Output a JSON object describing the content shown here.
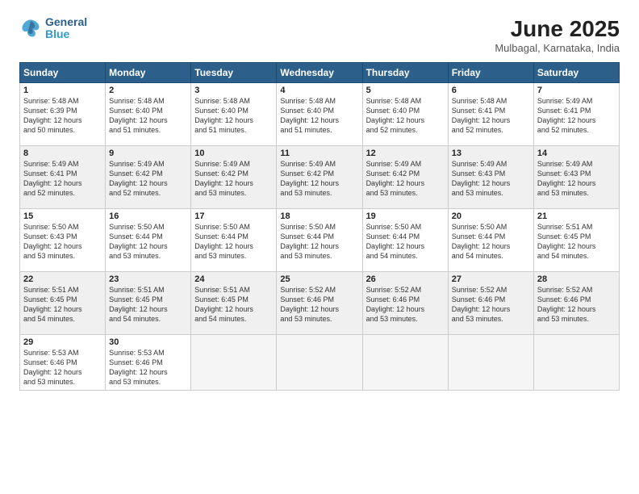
{
  "logo": {
    "line1": "General",
    "line2": "Blue"
  },
  "title": "June 2025",
  "location": "Mulbagal, Karnataka, India",
  "days_header": [
    "Sunday",
    "Monday",
    "Tuesday",
    "Wednesday",
    "Thursday",
    "Friday",
    "Saturday"
  ],
  "weeks": [
    [
      {
        "day": "1",
        "sunrise": "5:48 AM",
        "sunset": "6:39 PM",
        "daylight": "12 hours and 50 minutes."
      },
      {
        "day": "2",
        "sunrise": "5:48 AM",
        "sunset": "6:40 PM",
        "daylight": "12 hours and 51 minutes."
      },
      {
        "day": "3",
        "sunrise": "5:48 AM",
        "sunset": "6:40 PM",
        "daylight": "12 hours and 51 minutes."
      },
      {
        "day": "4",
        "sunrise": "5:48 AM",
        "sunset": "6:40 PM",
        "daylight": "12 hours and 51 minutes."
      },
      {
        "day": "5",
        "sunrise": "5:48 AM",
        "sunset": "6:40 PM",
        "daylight": "12 hours and 52 minutes."
      },
      {
        "day": "6",
        "sunrise": "5:48 AM",
        "sunset": "6:41 PM",
        "daylight": "12 hours and 52 minutes."
      },
      {
        "day": "7",
        "sunrise": "5:49 AM",
        "sunset": "6:41 PM",
        "daylight": "12 hours and 52 minutes."
      }
    ],
    [
      {
        "day": "8",
        "sunrise": "5:49 AM",
        "sunset": "6:41 PM",
        "daylight": "12 hours and 52 minutes."
      },
      {
        "day": "9",
        "sunrise": "5:49 AM",
        "sunset": "6:42 PM",
        "daylight": "12 hours and 52 minutes."
      },
      {
        "day": "10",
        "sunrise": "5:49 AM",
        "sunset": "6:42 PM",
        "daylight": "12 hours and 53 minutes."
      },
      {
        "day": "11",
        "sunrise": "5:49 AM",
        "sunset": "6:42 PM",
        "daylight": "12 hours and 53 minutes."
      },
      {
        "day": "12",
        "sunrise": "5:49 AM",
        "sunset": "6:42 PM",
        "daylight": "12 hours and 53 minutes."
      },
      {
        "day": "13",
        "sunrise": "5:49 AM",
        "sunset": "6:43 PM",
        "daylight": "12 hours and 53 minutes."
      },
      {
        "day": "14",
        "sunrise": "5:49 AM",
        "sunset": "6:43 PM",
        "daylight": "12 hours and 53 minutes."
      }
    ],
    [
      {
        "day": "15",
        "sunrise": "5:50 AM",
        "sunset": "6:43 PM",
        "daylight": "12 hours and 53 minutes."
      },
      {
        "day": "16",
        "sunrise": "5:50 AM",
        "sunset": "6:44 PM",
        "daylight": "12 hours and 53 minutes."
      },
      {
        "day": "17",
        "sunrise": "5:50 AM",
        "sunset": "6:44 PM",
        "daylight": "12 hours and 53 minutes."
      },
      {
        "day": "18",
        "sunrise": "5:50 AM",
        "sunset": "6:44 PM",
        "daylight": "12 hours and 53 minutes."
      },
      {
        "day": "19",
        "sunrise": "5:50 AM",
        "sunset": "6:44 PM",
        "daylight": "12 hours and 54 minutes."
      },
      {
        "day": "20",
        "sunrise": "5:50 AM",
        "sunset": "6:44 PM",
        "daylight": "12 hours and 54 minutes."
      },
      {
        "day": "21",
        "sunrise": "5:51 AM",
        "sunset": "6:45 PM",
        "daylight": "12 hours and 54 minutes."
      }
    ],
    [
      {
        "day": "22",
        "sunrise": "5:51 AM",
        "sunset": "6:45 PM",
        "daylight": "12 hours and 54 minutes."
      },
      {
        "day": "23",
        "sunrise": "5:51 AM",
        "sunset": "6:45 PM",
        "daylight": "12 hours and 54 minutes."
      },
      {
        "day": "24",
        "sunrise": "5:51 AM",
        "sunset": "6:45 PM",
        "daylight": "12 hours and 54 minutes."
      },
      {
        "day": "25",
        "sunrise": "5:52 AM",
        "sunset": "6:46 PM",
        "daylight": "12 hours and 53 minutes."
      },
      {
        "day": "26",
        "sunrise": "5:52 AM",
        "sunset": "6:46 PM",
        "daylight": "12 hours and 53 minutes."
      },
      {
        "day": "27",
        "sunrise": "5:52 AM",
        "sunset": "6:46 PM",
        "daylight": "12 hours and 53 minutes."
      },
      {
        "day": "28",
        "sunrise": "5:52 AM",
        "sunset": "6:46 PM",
        "daylight": "12 hours and 53 minutes."
      }
    ],
    [
      {
        "day": "29",
        "sunrise": "5:53 AM",
        "sunset": "6:46 PM",
        "daylight": "12 hours and 53 minutes."
      },
      {
        "day": "30",
        "sunrise": "5:53 AM",
        "sunset": "6:46 PM",
        "daylight": "12 hours and 53 minutes."
      },
      null,
      null,
      null,
      null,
      null
    ]
  ]
}
